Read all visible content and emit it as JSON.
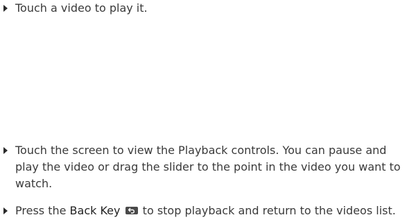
{
  "instructions": [
    {
      "text": "Touch a video to play it."
    },
    {
      "text": "Touch the screen to view the Playback controls. You can pause and play the video or drag the slider to the point in the video you want to watch."
    },
    {
      "before": "Press the ",
      "key_label": "Back Key",
      "key_icon": "back-arrow-icon",
      "after": " to stop playback and return to the videos list."
    }
  ]
}
